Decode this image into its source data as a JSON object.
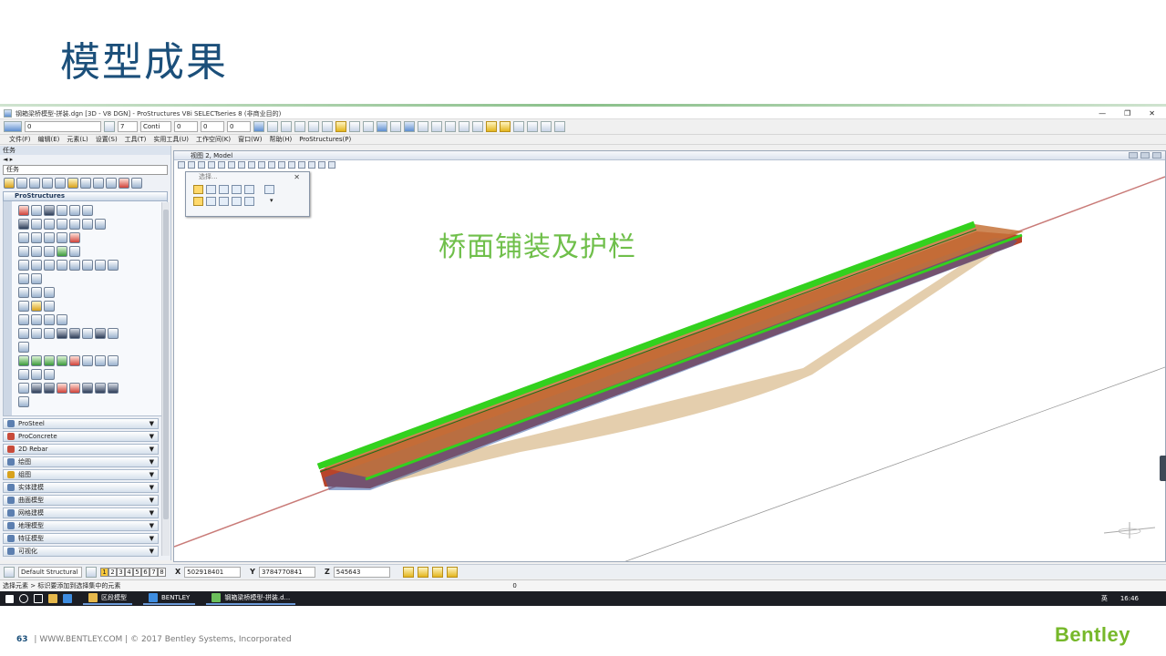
{
  "slide": {
    "title": "模型成果",
    "annotation": "桥面铺装及护栏",
    "page_number": "63",
    "footer_site": "WWW.BENTLEY.COM",
    "footer_copyright": "© 2017 Bentley Systems, Incorporated",
    "logo_text": "Bentley",
    "logo_color": "#76b82a"
  },
  "app": {
    "window_title": "钢箱梁桥模型-拼装.dgn [3D - V8 DGN] - ProStructures V8i SELECTseries 8 (非商业目的)",
    "toolbar": {
      "level_value": "0",
      "color_value": "7",
      "style_value": "Conti",
      "weight_value": "0",
      "transparency_value": "0",
      "priority_value": "0"
    },
    "menu": [
      "文件(F)",
      "编辑(E)",
      "元素(L)",
      "设置(S)",
      "工具(T)",
      "实用工具(U)",
      "工作空间(K)",
      "窗口(W)",
      "帮助(H)",
      "ProStructures(P)"
    ],
    "left_panel": {
      "title": "任务",
      "task_select": "任务",
      "prostructures_header": "ProStructures",
      "sections": [
        {
          "label": "ProSteel",
          "icon_color": "#5c7fb0"
        },
        {
          "label": "ProConcrete",
          "icon_color": "#c84b3a"
        },
        {
          "label": "2D Rebar",
          "icon_color": "#c84b3a"
        },
        {
          "label": "绘图",
          "icon_color": "#5c7fb0"
        },
        {
          "label": "组图",
          "icon_color": "#d8a21c"
        },
        {
          "label": "实体建模",
          "icon_color": "#5c7fb0"
        },
        {
          "label": "曲面模型",
          "icon_color": "#5c7fb0"
        },
        {
          "label": "网格建模",
          "icon_color": "#5c7fb0"
        },
        {
          "label": "地理模型",
          "icon_color": "#5c7fb0"
        },
        {
          "label": "特征模型",
          "icon_color": "#5c7fb0"
        },
        {
          "label": "可视化",
          "icon_color": "#5c7fb0"
        }
      ]
    },
    "viewport": {
      "title": "视图 2, Model",
      "selection_dialog_title": "选择..."
    },
    "status": {
      "view_group": "Default Structural",
      "pages": [
        "1",
        "2",
        "3",
        "4",
        "5",
        "6",
        "7",
        "8"
      ],
      "active_page": "1",
      "x_label": "X",
      "x_value": "502918401",
      "y_label": "Y",
      "y_value": "3784770841",
      "z_label": "Z",
      "z_value": "545643",
      "message": "选择元素 > 标识要添加到选择集中的元素",
      "level_right": "0"
    },
    "taskbar": {
      "items": [
        "区段模型",
        "BENTLEY",
        "钢箱梁桥模型-拼装.d..."
      ],
      "clock": "16:46",
      "lang": "英"
    }
  }
}
